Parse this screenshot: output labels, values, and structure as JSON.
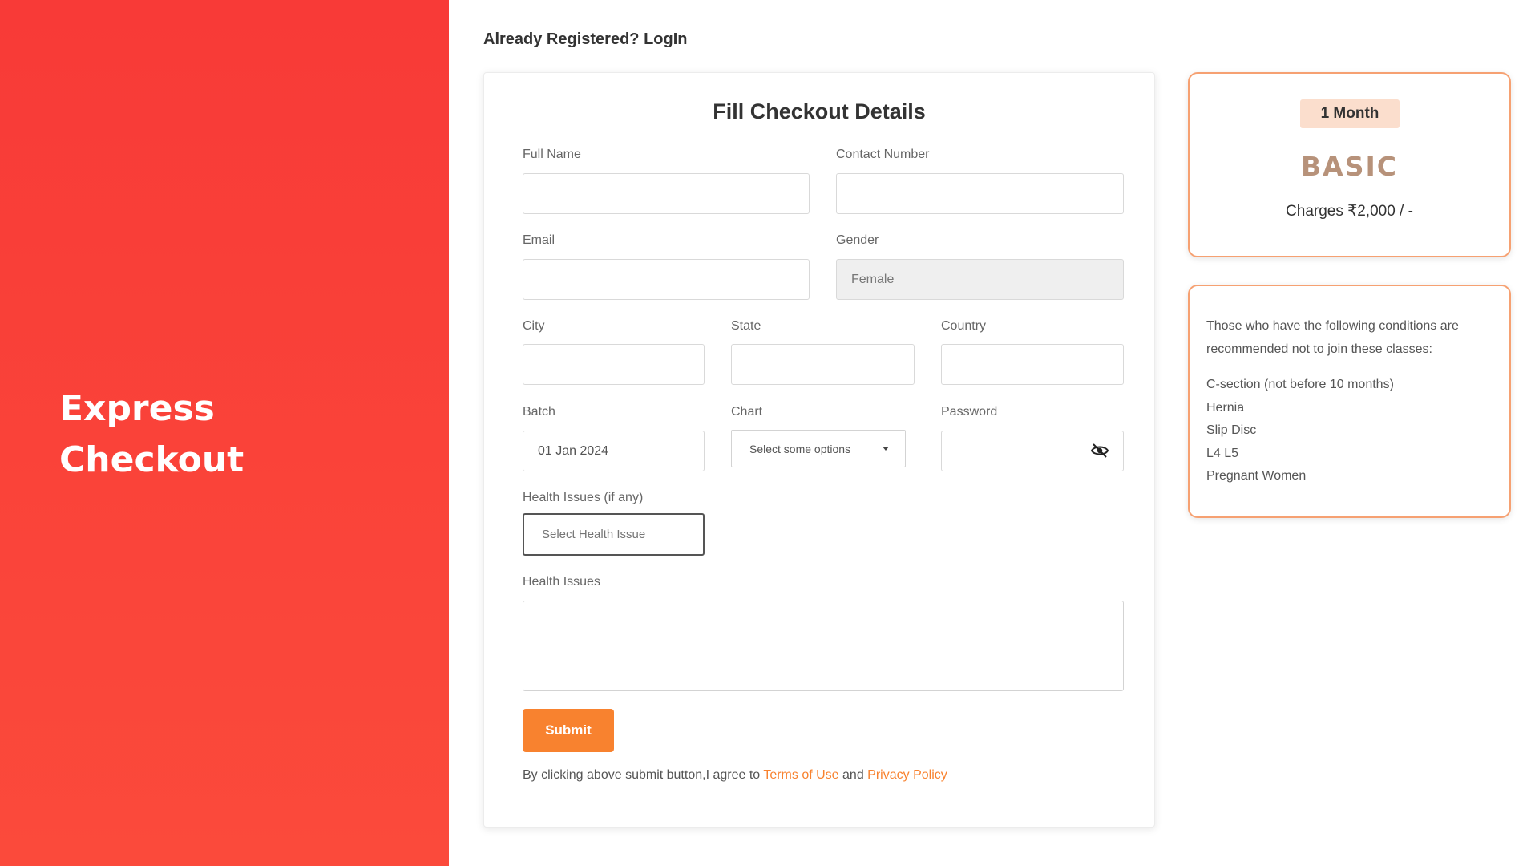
{
  "left_panel": {
    "title_line1": "Express",
    "title_line2": "Checkout"
  },
  "header": {
    "login_link": "Already Registered? LogIn"
  },
  "form": {
    "title": "Fill Checkout Details",
    "full_name_label": "Full Name",
    "contact_label": "Contact Number",
    "email_label": "Email",
    "gender_label": "Gender",
    "gender_value": "Female",
    "city_label": "City",
    "state_label": "State",
    "country_label": "Country",
    "batch_label": "Batch",
    "batch_value": "01 Jan 2024",
    "chart_label": "Chart",
    "chart_placeholder": "Select some options",
    "password_label": "Password",
    "health_issues_any_label": "Health Issues (if any)",
    "health_select_placeholder": "Select Health Issue",
    "health_issues_label": "Health Issues",
    "submit_label": "Submit",
    "terms_prefix": "By clicking above submit button,I agree to ",
    "terms_link": "Terms of Use",
    "terms_and": " and ",
    "privacy_link": "Privacy Policy"
  },
  "plan": {
    "duration": "1 Month",
    "name": "BASIC",
    "charges": "Charges ₹2,000 / -"
  },
  "conditions": {
    "intro": "Those who have the following conditions are recommended not to join these classes:",
    "items": [
      "C-section (not before 10 months)",
      "Hernia",
      "Slip Disc",
      "L4 L5",
      "Pregnant Women"
    ]
  },
  "colors": {
    "left_panel": "#f83a37",
    "accent": "#f8822f",
    "plan_border": "#f6a172",
    "plan_name": "#b7927a"
  }
}
